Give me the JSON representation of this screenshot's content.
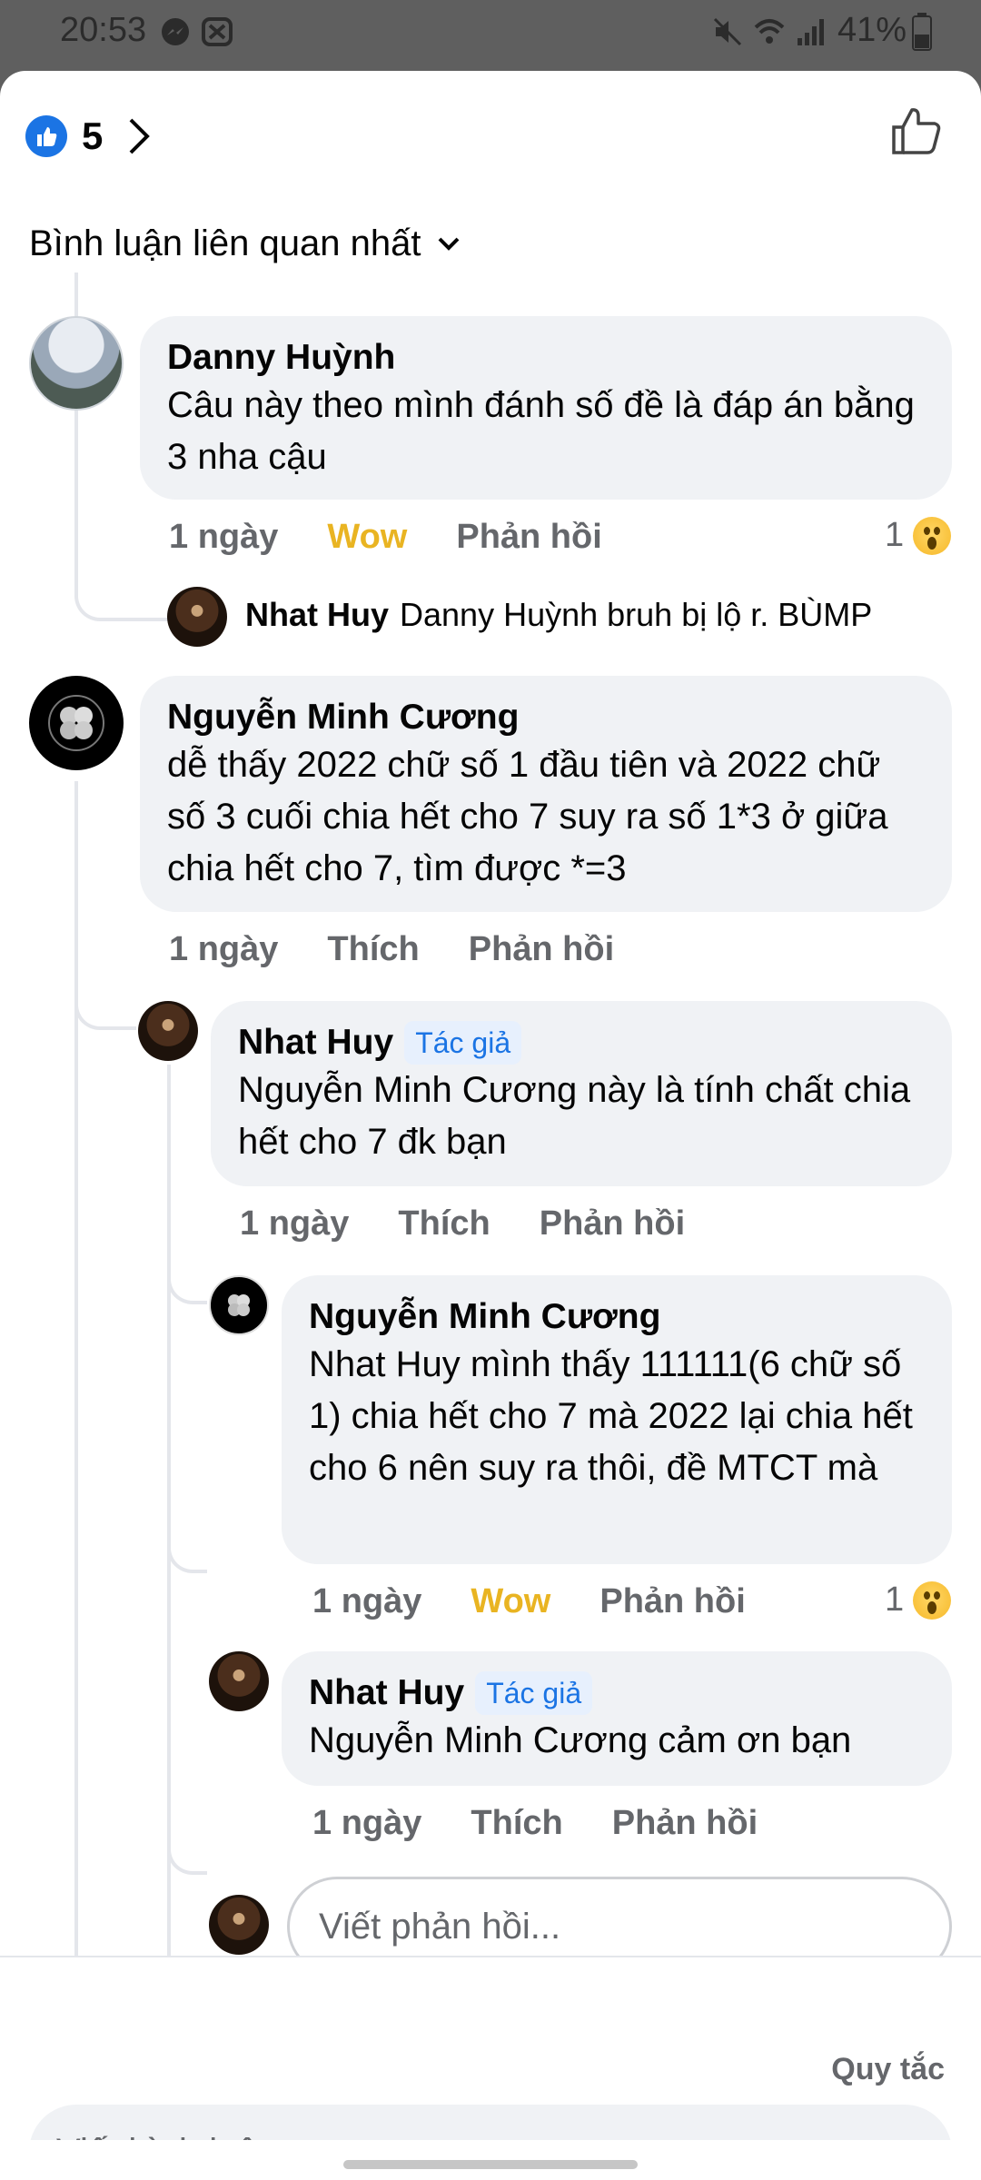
{
  "status_bar": {
    "time": "20:53",
    "battery": "41%",
    "icons": [
      "messenger-icon",
      "app-notification-icon",
      "mute-icon",
      "wifi-icon",
      "signal-icon",
      "battery-icon"
    ]
  },
  "header": {
    "reaction_count": "5",
    "like_icon": "like-reaction-icon",
    "chevron": "chevron-right-icon",
    "thumbs_up": "thumbs-up-outline-icon"
  },
  "sort": {
    "label": "Bình luận liên quan nhất",
    "icon": "chevron-down-icon"
  },
  "comments": [
    {
      "author": "Danny Huỳnh",
      "text": "Câu này theo mình đánh số đề là đáp án bằng 3 nha cậu",
      "time": "1 ngày",
      "reaction_label": "Wow",
      "reply_label": "Phản hồi",
      "reaction_count": "1",
      "reply_preview": {
        "author": "Nhat Huy",
        "text": "Danny Huỳnh bruh bị lộ r. BÙMP"
      }
    },
    {
      "author": "Nguyễn Minh Cương",
      "text": "dễ thấy 2022 chữ số 1 đầu tiên và 2022 chữ số 3 cuối chia hết cho 7 suy ra số 1*3 ở giữa chia hết cho 7, tìm được *=3",
      "time": "1 ngày",
      "like_label": "Thích",
      "reply_label": "Phản hồi",
      "replies": [
        {
          "author": "Nhat Huy",
          "badge": "Tác giả",
          "text": "Nguyễn Minh Cương này là tính chất chia hết cho 7 đk bạn",
          "time": "1 ngày",
          "like_label": "Thích",
          "reply_label": "Phản hồi"
        },
        {
          "author": "Nguyễn Minh Cương",
          "text": "Nhat Huy mình thấy 111111(6 chữ số 1) chia hết cho 7 mà 2022 lại chia hết cho 6 nên suy ra thôi, đề MTCT mà",
          "time": "1 ngày",
          "reaction_label": "Wow",
          "reply_label": "Phản hồi",
          "reaction_count": "1"
        },
        {
          "author": "Nhat Huy",
          "badge": "Tác giả",
          "text": "Nguyễn Minh Cương cảm ơn bạn",
          "time": "1 ngày",
          "like_label": "Thích",
          "reply_label": "Phản hồi"
        }
      ],
      "reply_placeholder": "Viết phản hồi..."
    }
  ],
  "footer": {
    "rules_label": "Quy tắc",
    "comment_placeholder": "Viết bình luận..."
  },
  "colors": {
    "accent": "#1b74e4",
    "wow": "#e9b422",
    "bubble": "#f0f2f5",
    "secondary_text": "#65676b"
  }
}
